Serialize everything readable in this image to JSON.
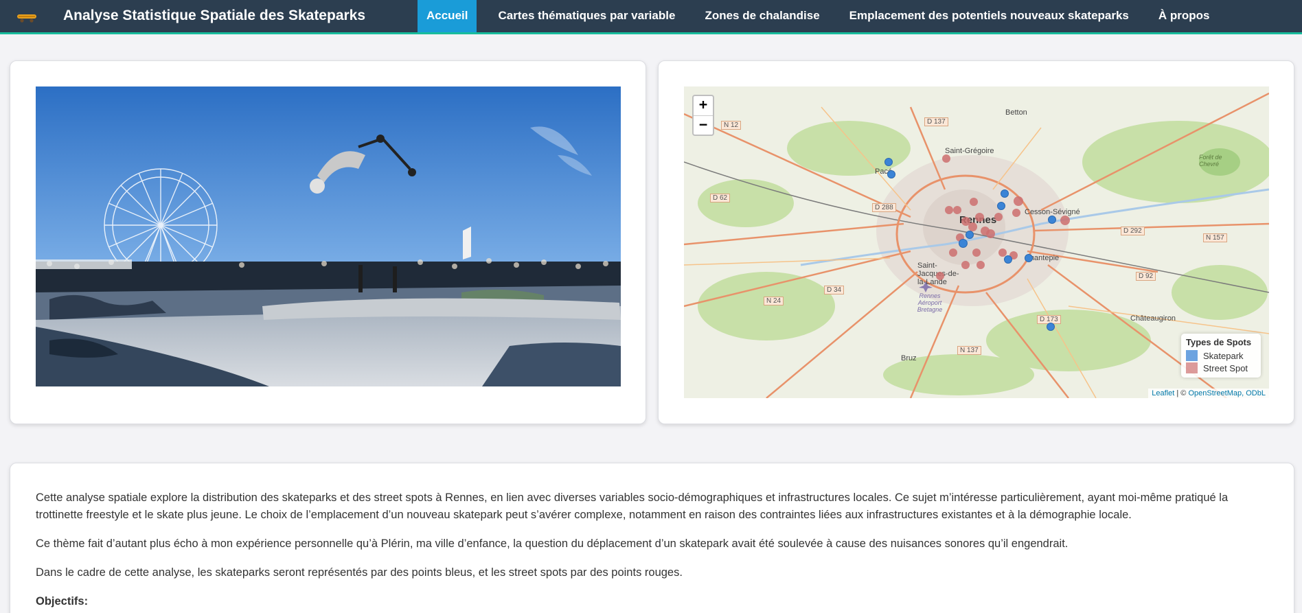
{
  "app": {
    "title": "Analyse Statistique Spatiale des Skateparks",
    "logo_icon": "skateboard-icon"
  },
  "nav": {
    "tabs": [
      {
        "label": "Accueil",
        "active": true
      },
      {
        "label": "Cartes thématiques par variable",
        "active": false
      },
      {
        "label": "Zones de chalandise",
        "active": false
      },
      {
        "label": "Emplacement des potentiels nouveaux skateparks",
        "active": false
      },
      {
        "label": "À propos",
        "active": false
      }
    ]
  },
  "map": {
    "zoom_in": "+",
    "zoom_out": "−",
    "towns": [
      "Betton",
      "Saint-Grégoire",
      "Pacé",
      "Rennes",
      "Cesson-Sévigné",
      "Saint-Jacques-de-la-Lande",
      "Chantepie",
      "Châteaugiron",
      "Bruz",
      "Rennes Aéroport Bretagne",
      "Forêt de Chevré"
    ],
    "road_labels": [
      "N 12",
      "D 137",
      "D 62",
      "D 288",
      "D 292",
      "N 157",
      "D 92",
      "N 24",
      "D 34",
      "D 173",
      "N 137"
    ],
    "legend": {
      "title": "Types de Spots",
      "items": [
        {
          "label": "Skatepark",
          "color": "#3b84d6"
        },
        {
          "label": "Street Spot",
          "color": "#d07a7a"
        }
      ]
    },
    "attribution": {
      "leaflet": "Leaflet",
      "sep": " | © ",
      "osm": "OpenStreetMap",
      "comma": ", ",
      "odbl": "ODbL"
    }
  },
  "intro": {
    "paragraphs": [
      "Cette analyse spatiale explore la distribution des skateparks et des street spots à Rennes, en lien avec diverses variables socio-démographiques et infrastructures locales. Ce sujet m’intéresse particulièrement, ayant moi-même pratiqué la trottinette freestyle et le skate plus jeune. Le choix de l’emplacement d’un nouveau skatepark peut s’avérer complexe, notamment en raison des contraintes liées aux infrastructures existantes et à la démographie locale.",
      "Ce thème fait d’autant plus écho à mon expérience personnelle qu’à Plérin, ma ville d’enfance, la question du déplacement d’un skatepark avait été soulevée à cause des nuisances sonores qu’il engendrait.",
      "Dans le cadre de cette analyse, les skateparks seront représentés par des points bleus, et les street spots par des points rouges."
    ],
    "objectives_label": "Objectifs:"
  }
}
